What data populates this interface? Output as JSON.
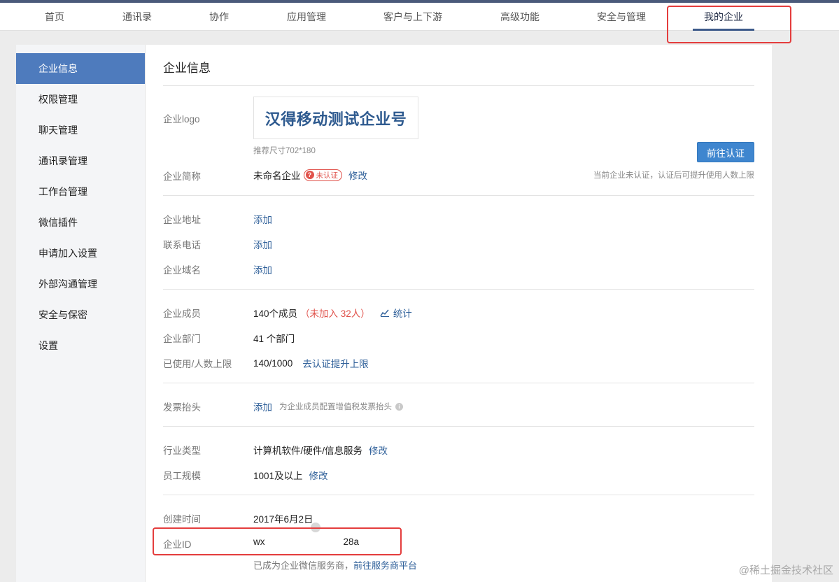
{
  "top_nav": {
    "items": [
      "首页",
      "通讯录",
      "协作",
      "应用管理",
      "客户与上下游",
      "高级功能",
      "安全与管理",
      "我的企业"
    ],
    "active": "我的企业"
  },
  "sidebar": {
    "items": [
      {
        "label": "企业信息",
        "active": true
      },
      {
        "label": "权限管理"
      },
      {
        "label": "聊天管理"
      },
      {
        "label": "通讯录管理"
      },
      {
        "label": "工作台管理"
      },
      {
        "label": "微信插件"
      },
      {
        "label": "申请加入设置"
      },
      {
        "label": "外部沟通管理"
      },
      {
        "label": "安全与保密"
      },
      {
        "label": "设置"
      }
    ]
  },
  "main": {
    "title": "企业信息",
    "logo": {
      "label": "企业logo",
      "text": "汉得移动测试企业号",
      "size_hint": "推荐尺寸702*180"
    },
    "cert_button": "前往认证",
    "cert_hint": "当前企业未认证，认证后可提升使用人数上限",
    "short_name": {
      "label": "企业简称",
      "value": "未命名企业",
      "badge": "未认证",
      "action": "修改"
    },
    "address": {
      "label": "企业地址",
      "action": "添加"
    },
    "phone": {
      "label": "联系电话",
      "action": "添加"
    },
    "domain": {
      "label": "企业域名",
      "action": "添加"
    },
    "members": {
      "label": "企业成员",
      "value": "140个成员",
      "not_joined": "（未加入 32人）",
      "stats": "统计"
    },
    "departments": {
      "label": "企业部门",
      "value": "41 个部门"
    },
    "usage": {
      "label": "已使用/人数上限",
      "value": "140/1000",
      "action": "去认证提升上限"
    },
    "invoice": {
      "label": "发票抬头",
      "action": "添加",
      "hint": "为企业成员配置增值税发票抬头"
    },
    "industry": {
      "label": "行业类型",
      "value": "计算机软件/硬件/信息服务",
      "action": "修改"
    },
    "scale": {
      "label": "员工规模",
      "value": "1001及以上",
      "action": "修改"
    },
    "created": {
      "label": "创建时间",
      "value": "2017年6月2日"
    },
    "corp_id": {
      "label": "企业ID",
      "visible_parts": [
        "wx",
        "",
        "28a"
      ]
    },
    "provider": {
      "text": "已成为企业微信服务商，",
      "action": "前往服务商平台"
    }
  },
  "watermark": "@稀土掘金技术社区",
  "colors": {
    "accent": "#4e7bbd",
    "link": "#2e5f99",
    "warning": "#e0524b",
    "highlight": "#e43d3d"
  }
}
